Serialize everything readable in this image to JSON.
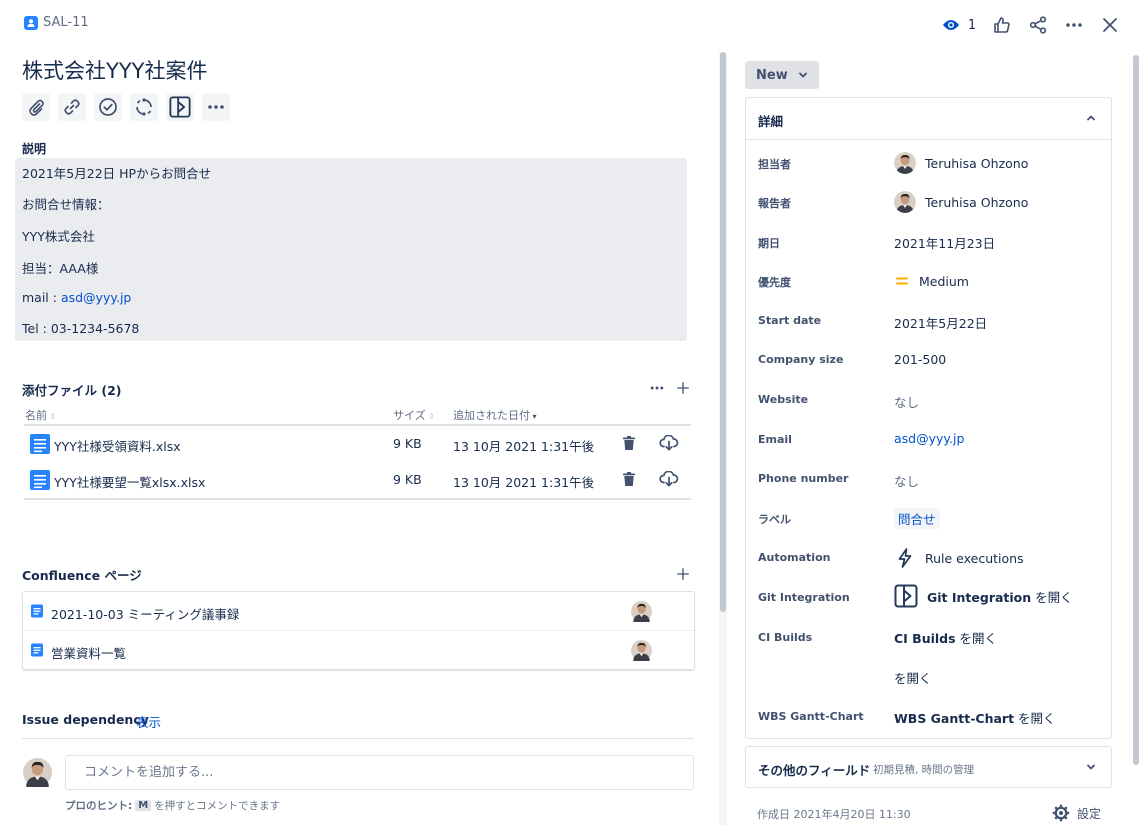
{
  "header": {
    "issue_key": "SAL-11",
    "watch_count": "1"
  },
  "issue": {
    "title": "株式会社YYY社案件"
  },
  "description": {
    "label": "説明",
    "lines": [
      "2021年5月22日 HPからお問合せ",
      "お問合せ情報：",
      "YYY株式会社",
      "担当：AAA様"
    ],
    "mail_prefix": "mail : ",
    "mail": "asd@yyy.jp",
    "tel": "Tel : 03-1234-5678"
  },
  "attachments": {
    "title": "添付ファイル (2)",
    "columns": {
      "name": "名前",
      "size": "サイズ",
      "date": "追加された日付"
    },
    "rows": [
      {
        "name": "YYY社様受領資料.xlsx",
        "size": "9 KB",
        "date": "13 10月 2021 1:31午後"
      },
      {
        "name": "YYY社様要望一覧xlsx.xlsx",
        "size": "9 KB",
        "date": "13 10月 2021 1:31午後"
      }
    ]
  },
  "confluence": {
    "title": "Confluence ページ",
    "pages": [
      {
        "title": "2021-10-03 ミーティング議事録"
      },
      {
        "title": "営業資料一覧"
      }
    ]
  },
  "dependency": {
    "label": "Issue dependency",
    "link": "表示"
  },
  "comment": {
    "placeholder": "コメントを追加する...",
    "tip_label": "プロのヒント:",
    "tip_key": "M",
    "tip_text": "を押すとコメントできます"
  },
  "status": {
    "label": "New"
  },
  "details": {
    "title": "詳細",
    "assignee_label": "担当者",
    "assignee": "Teruhisa Ohzono",
    "reporter_label": "報告者",
    "reporter": "Teruhisa Ohzono",
    "due_label": "期日",
    "due": "2021年11月23日",
    "priority_label": "優先度",
    "priority": "Medium",
    "start_label": "Start date",
    "start": "2021年5月22日",
    "company_size_label": "Company size",
    "company_size": "201-500",
    "website_label": "Website",
    "website": "なし",
    "email_label": "Email",
    "email": "asd@yyy.jp",
    "phone_label": "Phone number",
    "phone": "なし",
    "labels_label": "ラベル",
    "labels_value": "問合せ",
    "automation_label": "Automation",
    "automation": "Rule executions",
    "git_label": "Git Integration",
    "git_name": "Git Integration",
    "git_suffix": "を開く",
    "ci_label": "CI Builds",
    "ci_name": "CI Builds",
    "ci_suffix": "を開く",
    "extra_suffix": "を開く",
    "wbs_label": "WBS Gantt-Chart",
    "wbs_name": "WBS Gantt-Chart",
    "wbs_suffix": "を開く"
  },
  "other_fields": {
    "title": "その他のフィールド",
    "subtitle": "初期見積, 時間の管理"
  },
  "footer": {
    "created": "作成日 2021年4月20日 11:30",
    "settings": "設定"
  },
  "colors": {
    "link": "#0052cc",
    "text": "#172b4d",
    "priority_medium": "#ffab00",
    "doc_icon": "#2684ff"
  }
}
